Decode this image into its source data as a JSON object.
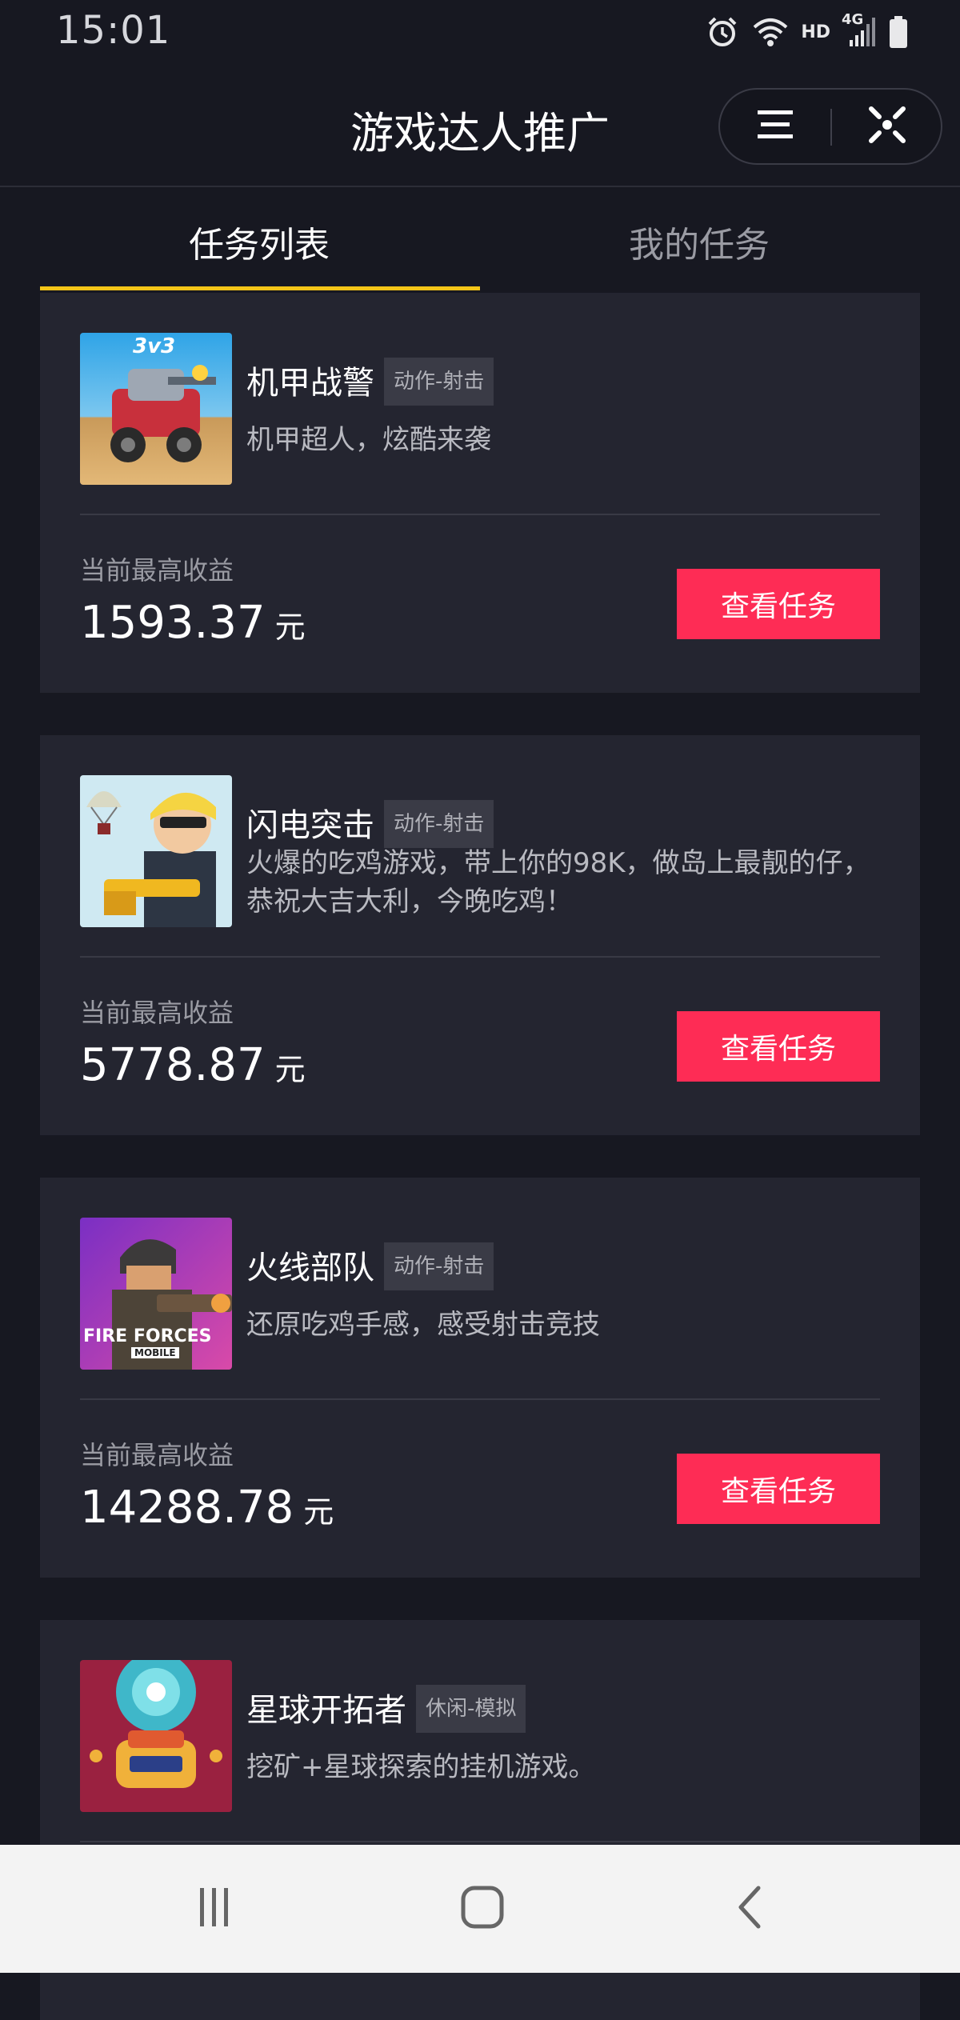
{
  "status_bar": {
    "time": "15:01",
    "hd_label": "HD",
    "network_label": "4G"
  },
  "header": {
    "title": "游戏达人推广",
    "menu_icon": "menu-icon",
    "close_icon": "close-icon"
  },
  "tabs": [
    {
      "label": "任务列表",
      "active": true
    },
    {
      "label": "我的任务",
      "active": false
    }
  ],
  "games": [
    {
      "name": "机甲战警",
      "tag": "动作-射击",
      "description": "机甲超人，炫酷来袭",
      "earnings_label": "当前最高收益",
      "earnings": "1593.37",
      "unit": "元",
      "button_label": "查看任务",
      "icon_text": "3v3"
    },
    {
      "name": "闪电突击",
      "tag": "动作-射击",
      "description": "火爆的吃鸡游戏，带上你的98K，做岛上最靓的仔，恭祝大吉大利，今晚吃鸡！",
      "earnings_label": "当前最高收益",
      "earnings": "5778.87",
      "unit": "元",
      "button_label": "查看任务"
    },
    {
      "name": "火线部队",
      "tag": "动作-射击",
      "description": "还原吃鸡手感，感受射击竞技",
      "earnings_label": "当前最高收益",
      "earnings": "14288.78",
      "unit": "元",
      "button_label": "查看任务",
      "icon_text": "FIRE FORCES",
      "icon_subtext": "MOBILE"
    },
    {
      "name": "星球开拓者",
      "tag": "休闲-模拟",
      "description": "挖矿+星球探索的挂机游戏。"
    }
  ],
  "colors": {
    "background": "#171821",
    "card": "#242530",
    "accent_button": "#fe2c55",
    "tab_underline": "#f5c518"
  },
  "nav_bar": {
    "recents_icon": "recents-icon",
    "home_icon": "home-icon",
    "back_icon": "back-icon"
  }
}
